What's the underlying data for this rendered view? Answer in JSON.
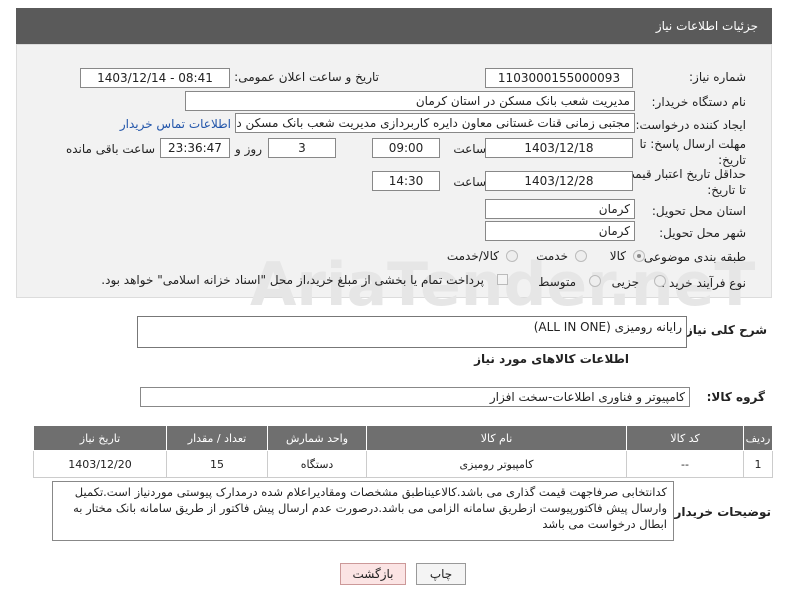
{
  "header": {
    "title": "جزئیات اطلاعات نیاز"
  },
  "watermark": "AriaTender.neT",
  "form": {
    "need_number": {
      "label": "شماره نیاز:",
      "value": "1103000155000093"
    },
    "announce_datetime": {
      "label": "تاریخ و ساعت اعلان عمومی:",
      "value": "1403/12/14 - 08:41"
    },
    "buyer_org": {
      "label": "نام دستگاه خریدار:",
      "value": "مدیریت شعب بانک مسکن در استان کرمان"
    },
    "requester": {
      "label": "ایجاد کننده درخواست:",
      "value": "مجتبی زمانی قنات غستانی معاون دایره کاربردازی مدیریت شعب بانک مسکن د",
      "contact_link": "اطلاعات تماس خریدار"
    },
    "reply_deadline": {
      "label": "مهلت ارسال پاسخ: تا تاریخ:",
      "date": "1403/12/18",
      "time_label": "ساعت",
      "time": "09:00",
      "days": "3",
      "days_label": "روز و",
      "remaining": "23:36:47",
      "remaining_label": "ساعت باقی مانده"
    },
    "price_validity": {
      "label": "حداقل تاریخ اعتبار قیمت: تا تاریخ:",
      "date": "1403/12/28",
      "time_label": "ساعت",
      "time": "14:30"
    },
    "delivery_province": {
      "label": "استان محل تحویل:",
      "value": "کرمان"
    },
    "delivery_city": {
      "label": "شهر محل تحویل:",
      "value": "کرمان"
    },
    "category": {
      "label": "طبقه بندی موضوعی:",
      "options": [
        "کالا",
        "خدمت",
        "کالا/خدمت"
      ],
      "selected": "کالا"
    },
    "process_type": {
      "label": "نوع فرآیند خرید :",
      "options": [
        "جزیی",
        "متوسط"
      ],
      "checkbox_text": "پرداخت تمام یا بخشی از مبلغ خرید،از محل \"اسناد خزانه اسلامی\" خواهد بود."
    }
  },
  "summary": {
    "label": "شرح کلی نیاز:",
    "value": "رایانه رومیزی (ALL   IN   ONE)"
  },
  "goods_section": {
    "title": "اطلاعات کالاهای مورد نیاز",
    "group_label": "گروه کالا:",
    "group_value": "کامپیوتر و فناوری اطلاعات-سخت افزار",
    "columns": [
      "ردیف",
      "کد کالا",
      "نام کالا",
      "واحد شمارش",
      "تعداد / مقدار",
      "تاریخ نیاز"
    ],
    "rows": [
      [
        "1",
        "--",
        "کامپیوتر رومیزی",
        "دستگاه",
        "15",
        "1403/12/20"
      ]
    ]
  },
  "buyer_notes": {
    "label": "توضیحات خریدار:",
    "text": "کدانتخابی صرفاجهت قیمت گذاری می باشد.کالاعیناطبق مشخصات ومقادیراعلام شده درمدارک پیوستی موردنیاز است.تکمیل وارسال پیش فاکتورپیوست ازطریق سامانه الزامی می باشد.درصورت عدم ارسال پیش فاکتور از طریق سامانه بانک مختار به ابطال درخواست می باشد"
  },
  "buttons": {
    "print": "چاپ",
    "back": "بازگشت"
  }
}
